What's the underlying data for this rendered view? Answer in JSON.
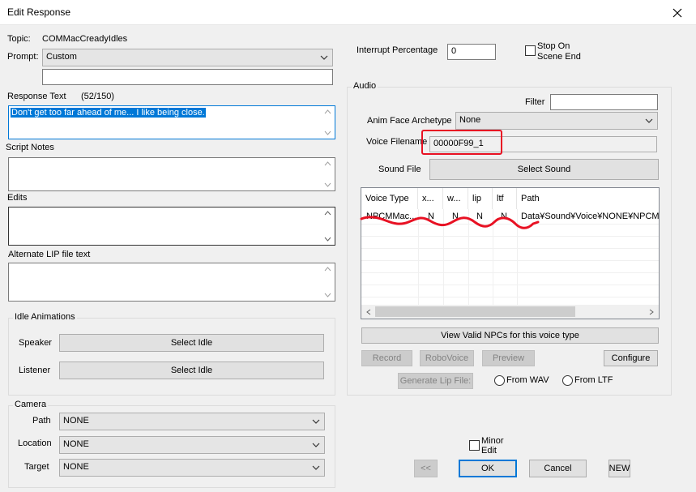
{
  "window": {
    "title": "Edit Response"
  },
  "left": {
    "topic_label": "Topic:",
    "topic_value": "COMMacCreadyIdles",
    "prompt_label": "Prompt:",
    "prompt_value": "Custom",
    "prompt_extra_value": "",
    "response_text_label": "Response Text",
    "response_text_count": "(52/150)",
    "response_text_value": "Don't get too far ahead of me... I like being close.",
    "script_notes_label": "Script Notes",
    "edits_label": "Edits",
    "alt_lip_label": "Alternate LIP file text",
    "idle_group_title": "Idle Animations",
    "speaker_label": "Speaker",
    "speaker_button": "Select Idle",
    "listener_label": "Listener",
    "listener_button": "Select Idle",
    "camera_group_title": "Camera",
    "path_label": "Path",
    "path_value": "NONE",
    "location_label": "Location",
    "location_value": "NONE",
    "target_label": "Target",
    "target_value": "NONE"
  },
  "right": {
    "interrupt_label": "Interrupt Percentage",
    "interrupt_value": "0",
    "stop_on_scene_end_label_1": "Stop On",
    "stop_on_scene_end_label_2": "Scene End",
    "audio_group_title": "Audio",
    "filter_label": "Filter",
    "filter_value": "",
    "anim_face_label": "Anim Face Archetype",
    "anim_face_value": "None",
    "voice_filename_label": "Voice Filename",
    "voice_filename_value": "00000F99_1",
    "sound_file_label": "Sound File",
    "select_sound_button": "Select Sound",
    "table": {
      "columns": [
        "Voice Type",
        "x...",
        "w...",
        "lip",
        "ltf",
        "Path"
      ],
      "rows": [
        [
          "NPCMMac...",
          "N",
          "N",
          "N",
          "N",
          "Data¥Sound¥Voice¥NONE¥NPCMMa"
        ]
      ]
    },
    "view_valid_npcs_button": "View Valid NPCs for this voice type",
    "record_button": "Record",
    "robovoice_button": "RoboVoice",
    "preview_button": "Preview",
    "configure_button": "Configure",
    "generate_lip_button": "Generate Lip File:",
    "from_wav_label": "From WAV",
    "from_ltf_label": "From LTF"
  },
  "bottom": {
    "minor_edit_label_1": "Minor",
    "minor_edit_label_2": "Edit",
    "prev_button": "<<",
    "ok_button": "OK",
    "cancel_button": "Cancel",
    "new_button": "NEW"
  },
  "colors": {
    "selection": "#0078d7",
    "annotation_red": "#e81123",
    "default_button_border": "#0078d7"
  },
  "icons": {
    "close": "close-icon",
    "dropdown": "chevron-down-icon",
    "scroll_up": "scroll-up-arrow-icon",
    "scroll_down": "scroll-down-arrow-icon"
  }
}
